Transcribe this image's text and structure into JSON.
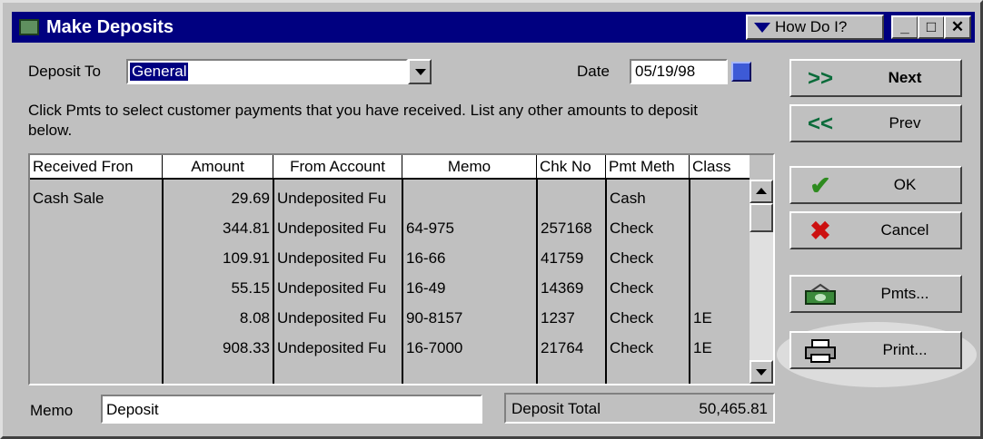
{
  "window": {
    "title": "Make Deposits",
    "how_do_i": "How Do I?",
    "minimize": "_",
    "maximize": "□",
    "close": "✕"
  },
  "deposit_to": {
    "label": "Deposit To",
    "value": "General"
  },
  "date": {
    "label": "Date",
    "value": "05/19/98"
  },
  "instructions": "Click Pmts to select customer payments that you have received. List any other amounts to deposit below.",
  "grid": {
    "columns": [
      "Received Fron",
      "Amount",
      "From Account",
      "Memo",
      "Chk No",
      "Pmt Meth",
      "Class"
    ],
    "rows": [
      {
        "received_from": "Cash Sale",
        "amount": "29.69",
        "from_account": "Undeposited Fu",
        "memo": "",
        "chk_no": "",
        "pmt_method": "Cash",
        "class": ""
      },
      {
        "received_from": "",
        "amount": "344.81",
        "from_account": "Undeposited Fu",
        "memo": "64-975",
        "chk_no": "257168",
        "pmt_method": "Check",
        "class": ""
      },
      {
        "received_from": "",
        "amount": "109.91",
        "from_account": "Undeposited Fu",
        "memo": "16-66",
        "chk_no": "41759",
        "pmt_method": "Check",
        "class": ""
      },
      {
        "received_from": "",
        "amount": "55.15",
        "from_account": "Undeposited Fu",
        "memo": "16-49",
        "chk_no": "14369",
        "pmt_method": "Check",
        "class": ""
      },
      {
        "received_from": "",
        "amount": "8.08",
        "from_account": "Undeposited Fu",
        "memo": "90-8157",
        "chk_no": "1237",
        "pmt_method": "Check",
        "class": "1E"
      },
      {
        "received_from": "",
        "amount": "908.33",
        "from_account": "Undeposited Fu",
        "memo": "16-7000",
        "chk_no": "21764",
        "pmt_method": "Check",
        "class": "1E"
      }
    ]
  },
  "memo": {
    "label": "Memo",
    "value": "Deposit"
  },
  "deposit_total": {
    "label": "Deposit Total",
    "value": "50,465.81"
  },
  "buttons": {
    "next": {
      "icon": ">>",
      "label": "Next"
    },
    "prev": {
      "icon": "<<",
      "label": "Prev"
    },
    "ok": {
      "icon": "✔",
      "label": "OK"
    },
    "cancel": {
      "icon": "✖",
      "label": "Cancel"
    },
    "pmts": {
      "icon": "money-icon",
      "label": "Pmts..."
    },
    "print": {
      "icon": "printer-icon",
      "label": "Print..."
    }
  },
  "colors": {
    "title_bar": "#000080",
    "selection": "#000080",
    "ok_check": "#2e8b1f",
    "cancel_x": "#cc1010",
    "nav_arrows": "#0a6b3a"
  }
}
